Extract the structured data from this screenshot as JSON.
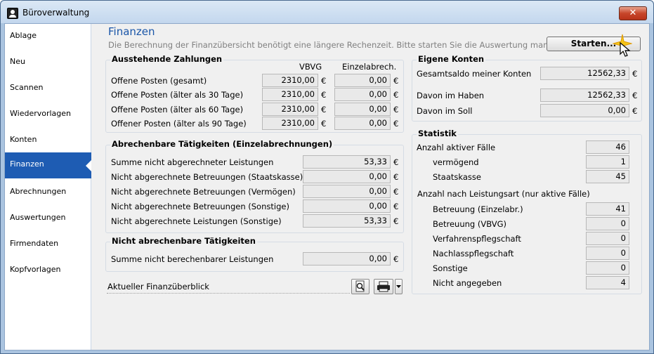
{
  "window": {
    "title": "Büroverwaltung",
    "close_glyph": "✕"
  },
  "sidebar": {
    "items": [
      {
        "label": "Ablage"
      },
      {
        "label": "Neu"
      },
      {
        "label": "Scannen"
      },
      {
        "label": "Wiedervorlagen"
      },
      {
        "label": "Konten"
      },
      {
        "label": "Finanzen",
        "active": true
      },
      {
        "label": "Abrechnungen"
      },
      {
        "label": "Auswertungen"
      },
      {
        "label": "Firmendaten"
      },
      {
        "label": "Kopfvorlagen"
      }
    ]
  },
  "header": {
    "title": "Finanzen",
    "subtitle": "Die Berechnung der Finanzübersicht benötigt eine längere Rechenzeit. Bitte starten Sie die Auswertung manuell",
    "start_button": "Starten..."
  },
  "currency": "€",
  "ausstehend": {
    "title": "Ausstehende Zahlungen",
    "col_vbvg": "VBVG",
    "col_einzel": "Einzelabrech.",
    "rows": [
      {
        "label": "Offene Posten (gesamt)",
        "vbvg": "2310,00",
        "einzel": "0,00"
      },
      {
        "label": "Offene Posten (älter als 30 Tage)",
        "vbvg": "2310,00",
        "einzel": "0,00"
      },
      {
        "label": "Offene Posten (älter als 60 Tage)",
        "vbvg": "2310,00",
        "einzel": "0,00"
      },
      {
        "label": "Offener Posten (älter als 90 Tage)",
        "vbvg": "2310,00",
        "einzel": "0,00"
      }
    ]
  },
  "abrechenbar": {
    "title": "Abrechenbare Tätigkeiten (Einzelabrechnungen)",
    "rows": [
      {
        "label": "Summe nicht abgerechneter Leistungen",
        "value": "53,33"
      },
      {
        "label": "Nicht abgerechnete Betreuungen (Staatskasse)",
        "value": "0,00"
      },
      {
        "label": "Nicht abgerechnete Betreuungen (Vermögen)",
        "value": "0,00"
      },
      {
        "label": "Nicht abgerechnete Betreuungen (Sonstige)",
        "value": "0,00"
      },
      {
        "label": "Nicht abgerechnete Leistungen (Sonstige)",
        "value": "53,33"
      }
    ]
  },
  "nicht_abrechenbar": {
    "title": "Nicht abrechenbare Tätigkeiten",
    "rows": [
      {
        "label": "Summe nicht berechenbarer Leistungen",
        "value": "0,00"
      }
    ]
  },
  "eigene_konten": {
    "title": "Eigene Konten",
    "rows": [
      {
        "label": "Gesamtsaldo meiner Konten",
        "value": "12562,33"
      },
      {
        "label": "Davon im Haben",
        "value": "12562,33"
      },
      {
        "label": "Davon im Soll",
        "value": "0,00"
      }
    ]
  },
  "statistik": {
    "title": "Statistik",
    "aktive_label": "Anzahl aktiver Fälle",
    "aktive_value": "46",
    "aktive_sub": [
      {
        "label": "vermögend",
        "value": "1"
      },
      {
        "label": "Staatskasse",
        "value": "45"
      }
    ],
    "leistungsart_label": "Anzahl nach Leistungsart (nur aktive Fälle)",
    "leistungsart": [
      {
        "label": "Betreuung (Einzelabr.)",
        "value": "41"
      },
      {
        "label": "Betreuung (VBVG)",
        "value": "0"
      },
      {
        "label": "Verfahrenspflegschaft",
        "value": "0"
      },
      {
        "label": "Nachlasspflegschaft",
        "value": "0"
      },
      {
        "label": "Sonstige",
        "value": "0"
      },
      {
        "label": "Nicht angegeben",
        "value": "4"
      }
    ]
  },
  "bottom": {
    "label": "Aktueller Finanzüberblick"
  },
  "icons": {
    "app": "app-icon",
    "preview": "preview-icon",
    "print": "printer-icon",
    "dropdown": "chevron-down-icon",
    "sparkle": "sparkle-icon",
    "cursor": "mouse-cursor-icon"
  }
}
